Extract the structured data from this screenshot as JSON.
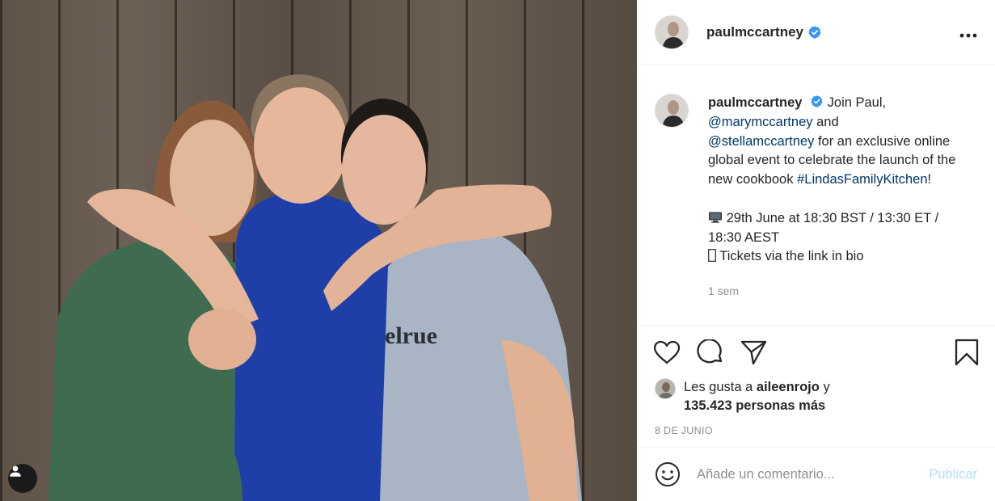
{
  "post": {
    "username": "paulmccartney",
    "more_icon": "more-horizontal-icon",
    "caption": {
      "username": "paulmccartney",
      "line1_text": " Join Paul,",
      "mention1": "@marymccartney",
      "line2_rest": " and",
      "mention2": "@stellamccartney",
      "line3_rest": " for an exclusive online global event to celebrate the launch of the new cookbook",
      "hashtag": "#LindasFamilyKitchen",
      "hashtag_suffix": "!",
      "event_line": "29th June at 18:30 BST / 13:30 ET / 18:30 AEST",
      "tickets_line": "Tickets via the link in bio"
    },
    "time_ago": "1 sem",
    "likes": {
      "prefix": "Les gusta a ",
      "liker": "aileenrojo",
      "and": " y",
      "others": "135.423 personas más"
    },
    "date": "8 DE JUNIO",
    "comment": {
      "placeholder": "Añade un comentario...",
      "publish_label": "Publicar"
    }
  },
  "colors": {
    "link": "#00376b",
    "muted": "#8e8e8e",
    "publish_disabled": "#b2dffc",
    "verified": "#3897f0"
  }
}
